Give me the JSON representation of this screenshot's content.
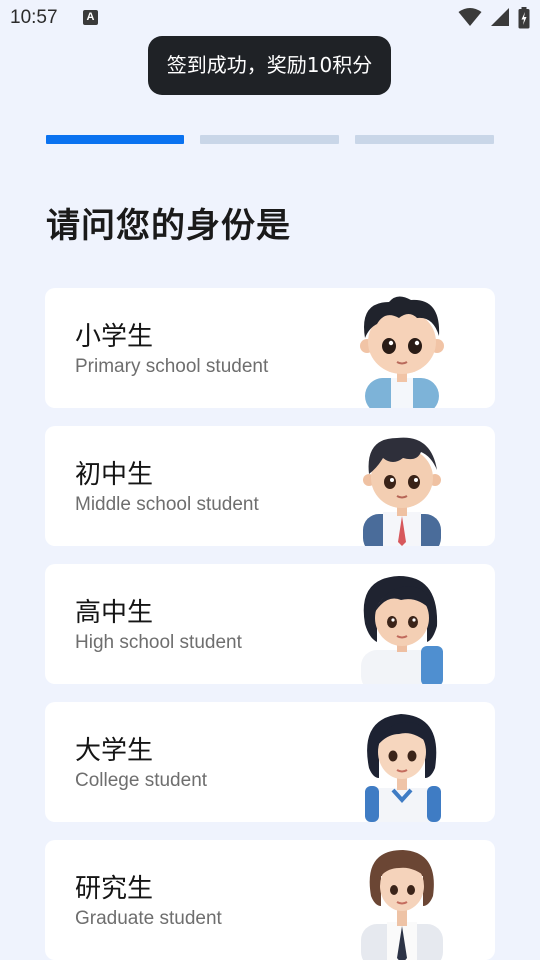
{
  "status_bar": {
    "time": "10:57",
    "notification_icon": "a-letter-icon",
    "icons": [
      "wifi-icon",
      "cellular-signal-icon",
      "battery-charging-icon"
    ]
  },
  "toast": {
    "text": "签到成功，奖励10积分"
  },
  "progress": {
    "total_steps": 3,
    "current_step": 1,
    "active_color": "#0a72f0",
    "inactive_color": "#c9d6e8"
  },
  "question": "请问您的身份是",
  "options": [
    {
      "title": "小学生",
      "subtitle": "Primary school student",
      "avatar": "boy-child-avatar"
    },
    {
      "title": "初中生",
      "subtitle": "Middle school student",
      "avatar": "boy-teen-avatar"
    },
    {
      "title": "高中生",
      "subtitle": "High school student",
      "avatar": "girl-teen-avatar"
    },
    {
      "title": "大学生",
      "subtitle": "College student",
      "avatar": "young-woman-avatar"
    },
    {
      "title": "研究生",
      "subtitle": "Graduate student",
      "avatar": "graduate-woman-avatar"
    }
  ],
  "colors": {
    "background": "#eff3fd",
    "card": "#ffffff",
    "toast": "#1f2226"
  }
}
